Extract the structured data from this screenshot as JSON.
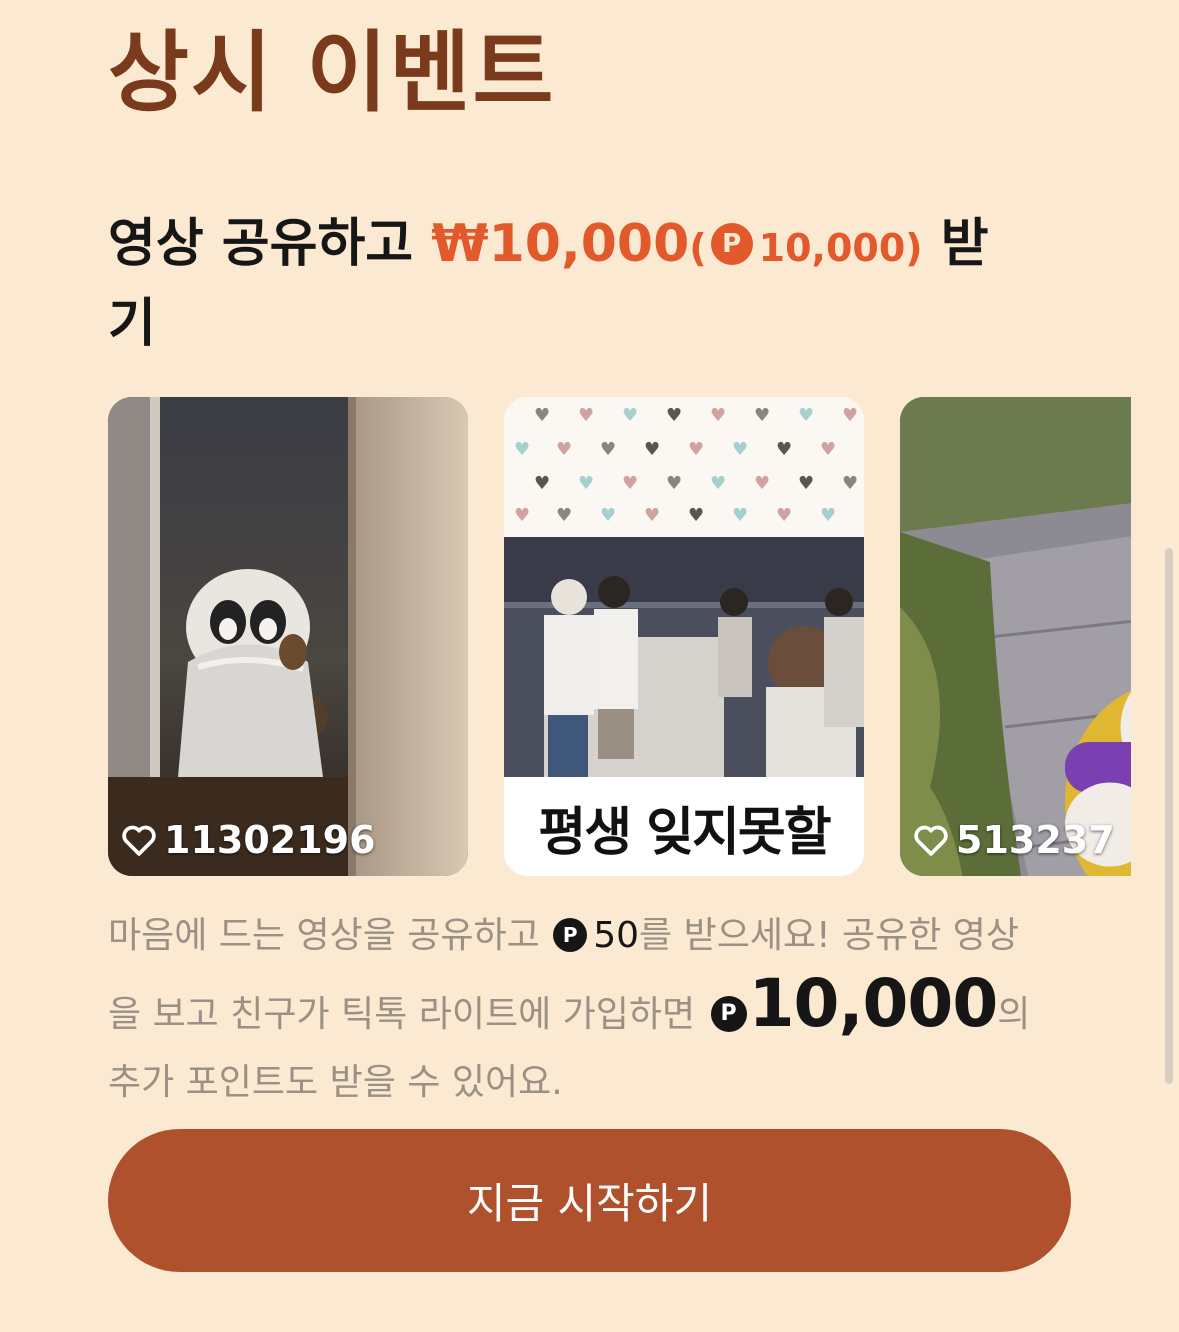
{
  "section": {
    "title": "상시 이벤트"
  },
  "promo": {
    "prefix": "영상 공유하고 ",
    "amount": "₩10,000",
    "paren_open": "(",
    "coin_symbol": "P",
    "points": "10,000",
    "paren_close": ")",
    "suffix": " 받기"
  },
  "videos": [
    {
      "likes": "11302196",
      "thumbnail": "penguin-plush-in-bonnet"
    },
    {
      "likes": "",
      "caption": "평생 잊지못할",
      "thumbnail": "group-of-friends-at-river-night"
    },
    {
      "likes": "513237",
      "thumbnail": "dog-in-stroller-on-path"
    }
  ],
  "description": {
    "part1": "마음에 드는 영상을 공유하고 ",
    "coin_symbol": "P",
    "reward_small": "50",
    "part2": "를 받으세요! 공유한 영상을 보고 친구가 틱톡 라이트에 가입하면 ",
    "reward_big": "10,000",
    "part3": "의 추가 포인트도 받을 수 있어요."
  },
  "cta": {
    "label": "지금 시작하기"
  },
  "colors": {
    "background": "#fbead1",
    "title": "#7a3a1c",
    "accent": "#e2592c",
    "button": "#b0512d"
  }
}
